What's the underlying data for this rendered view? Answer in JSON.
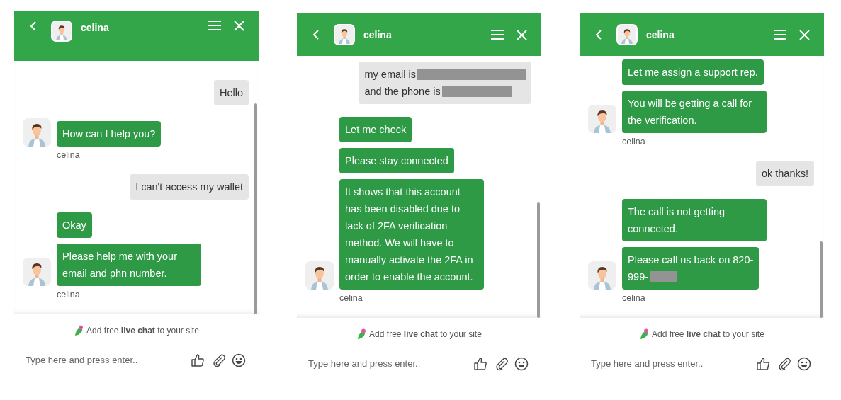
{
  "panels": [
    {
      "header": {
        "name": "celina"
      },
      "groups": [
        {
          "kind": "user",
          "bubbles": [
            {
              "lines": [
                {
                  "text": "Hello"
                }
              ]
            }
          ]
        },
        {
          "kind": "agent",
          "sender": "celina",
          "bubbles": [
            {
              "lines": [
                {
                  "text": "How can I help you?"
                }
              ]
            }
          ]
        },
        {
          "kind": "user",
          "bubbles": [
            {
              "lines": [
                {
                  "text": "I can't access my wallet"
                }
              ]
            }
          ]
        },
        {
          "kind": "agent",
          "sender": "celina",
          "bubbles": [
            {
              "lines": [
                {
                  "text": "Okay"
                }
              ]
            },
            {
              "lines": [
                {
                  "text": "Please help me with your email and phn number."
                }
              ]
            }
          ]
        }
      ],
      "branding": "Add free **live chat** to your site",
      "input": {
        "placeholder": "Type here and press enter.."
      }
    },
    {
      "header": {
        "name": "celina"
      },
      "groups": [
        {
          "kind": "user",
          "bubbles": [
            {
              "lines": [
                {
                  "text": "my email is",
                  "redacted": true
                },
                {
                  "text": "and the phone is",
                  "redacted": true
                }
              ]
            }
          ]
        },
        {
          "kind": "agent",
          "sender": "celina",
          "bubbles": [
            {
              "lines": [
                {
                  "text": "Let me check"
                }
              ]
            },
            {
              "lines": [
                {
                  "text": "Please stay connected"
                }
              ]
            },
            {
              "lines": [
                {
                  "text": "It shows that this account has been disabled due to lack of 2FA verification method. We will have to manually activate the 2FA in order to enable the account."
                }
              ]
            }
          ]
        }
      ],
      "branding": "Add free **live chat** to your site",
      "input": {
        "placeholder": "Type here and press enter.."
      }
    },
    {
      "header": {
        "name": "celina"
      },
      "groups": [
        {
          "kind": "agent",
          "sender": "celina",
          "bubbles": [
            {
              "lines": [
                {
                  "text": "Let me assign a support rep."
                }
              ]
            },
            {
              "lines": [
                {
                  "text": "You will be getting a call for the verification."
                }
              ]
            }
          ]
        },
        {
          "kind": "user",
          "bubbles": [
            {
              "lines": [
                {
                  "text": "ok thanks!"
                }
              ]
            }
          ]
        },
        {
          "kind": "agent",
          "sender": "celina",
          "bubbles": [
            {
              "lines": [
                {
                  "text": "The call is not getting connected."
                }
              ]
            },
            {
              "lines": [
                {
                  "text": "Please call us back on 820-"
                },
                {
                  "text": "999-",
                  "redacted": true
                }
              ]
            }
          ]
        }
      ],
      "branding": "Add free **live chat** to your site",
      "input": {
        "placeholder": "Type here and press enter.."
      }
    }
  ]
}
